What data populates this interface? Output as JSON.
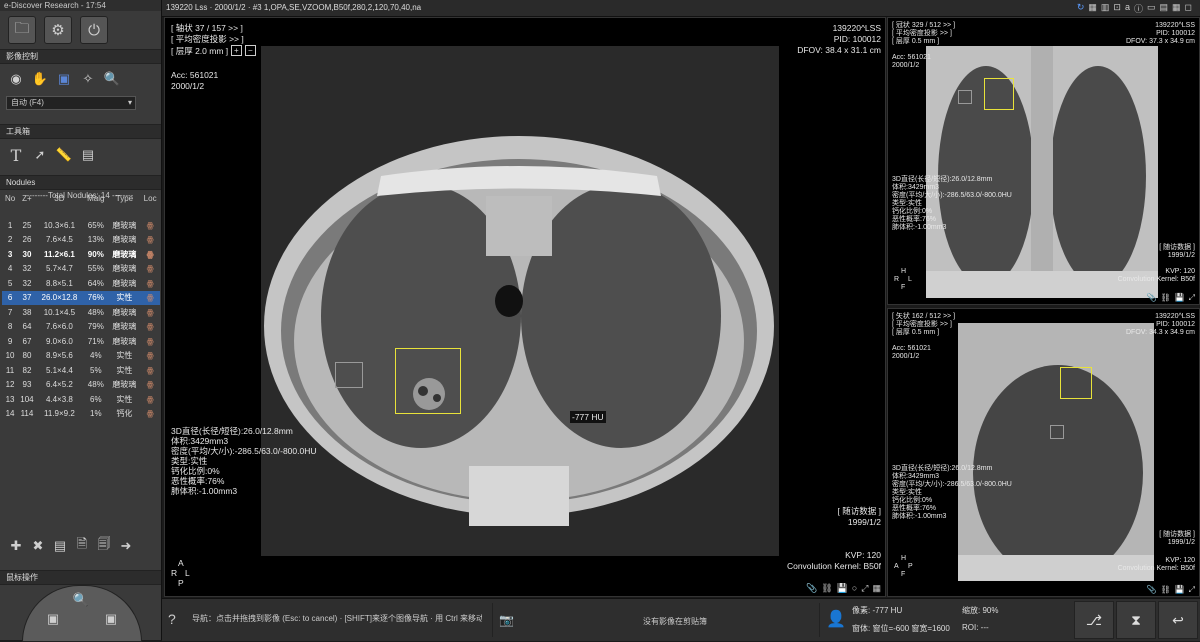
{
  "app": {
    "title": "e-Discover Research - 17:54"
  },
  "left": {
    "sections": {
      "imaging": "影像控制",
      "tools": "工具箱",
      "nodules": "Nodules",
      "mouse": "鼠标操作"
    },
    "mode_dropdown": "自动 (F4)",
    "table_headers": [
      "No",
      "Z+",
      "3D",
      "Malg",
      "Type",
      "Loc"
    ],
    "total_label": "--------Total Nodules: 14 --------",
    "rows": [
      {
        "no": "1",
        "z": "25",
        "d": "10.3×6.1",
        "malg": "65%",
        "type": "磨玻璃"
      },
      {
        "no": "2",
        "z": "26",
        "d": "7.6×4.5",
        "malg": "13%",
        "type": "磨玻璃"
      },
      {
        "no": "3",
        "z": "30",
        "d": "11.2×6.1",
        "malg": "90%",
        "type": "磨玻璃"
      },
      {
        "no": "4",
        "z": "32",
        "d": "5.7×4.7",
        "malg": "55%",
        "type": "磨玻璃"
      },
      {
        "no": "5",
        "z": "32",
        "d": "8.8×5.1",
        "malg": "64%",
        "type": "磨玻璃"
      },
      {
        "no": "6",
        "z": "37",
        "d": "26.0×12.8",
        "malg": "76%",
        "type": "实性"
      },
      {
        "no": "7",
        "z": "38",
        "d": "10.1×4.5",
        "malg": "48%",
        "type": "磨玻璃"
      },
      {
        "no": "8",
        "z": "64",
        "d": "7.6×6.0",
        "malg": "79%",
        "type": "磨玻璃"
      },
      {
        "no": "9",
        "z": "67",
        "d": "9.0×6.0",
        "malg": "71%",
        "type": "磨玻璃"
      },
      {
        "no": "10",
        "z": "80",
        "d": "8.9×5.6",
        "malg": "4%",
        "type": "实性"
      },
      {
        "no": "11",
        "z": "82",
        "d": "5.1×4.4",
        "malg": "5%",
        "type": "实性"
      },
      {
        "no": "12",
        "z": "93",
        "d": "6.4×5.2",
        "malg": "48%",
        "type": "磨玻璃"
      },
      {
        "no": "13",
        "z": "104",
        "d": "4.4×3.8",
        "malg": "6%",
        "type": "实性"
      },
      {
        "no": "14",
        "z": "114",
        "d": "11.9×9.2",
        "malg": "1%",
        "type": "钙化"
      }
    ]
  },
  "topbar": {
    "text": "139220 Lss  ·  2000/1/2  ·  #3 1,OPA,SE,VZOOM,B50f,280,2,120,70,40,na"
  },
  "axial": {
    "tl1": "[ 轴状 37 / 157 >> ]",
    "tl2": "[ 平均密度投影 >> ]",
    "tl3": "[ 层厚 2.0 mm ]",
    "acc": "Acc: 561021",
    "date": "2000/1/2",
    "tr1": "139220^LSS",
    "tr2": "PID: 100012",
    "tr3": "DFOV: 38.4 x 31.1 cm",
    "hu": "-777 HU",
    "m1": "3D直径(长径/短径):26.0/12.8mm",
    "m2": "体积:3429mm3",
    "m3": "密度(平均/大/小):-286.5/63.0/-800.0HU",
    "m4": "类型:实性",
    "m5": "钙化比例:0%",
    "m6": "恶性概率:76%",
    "m7": "肺体积:-1.00mm3",
    "follow": "[ 随访数据 ]",
    "follow_date": "1999/1/2",
    "kvp": "KVP: 120",
    "kernel": "Convolution Kernel: B50f",
    "orient": [
      "A",
      "R",
      "L",
      "P"
    ]
  },
  "coronal": {
    "tl1": "[ 冠状 329 / 512 >> ]",
    "tl2": "[ 平均密度投影 >> ]",
    "tl3": "[ 层厚 0.5 mm ]",
    "acc": "Acc: 561021",
    "date": "2000/1/2",
    "tr1": "139220^LSS",
    "tr2": "PID: 100012",
    "tr3": "DFOV: 37.3 x 34.9 cm",
    "m1": "3D直径(长径/短径):26.0/12.8mm",
    "m2": "体积:3429mm3",
    "m3": "密度(平均/大/小):-286.5/63.0/-800.0HU",
    "m4": "类型:实性",
    "m5": "钙化比例:0%",
    "m6": "恶性概率:76%",
    "m7": "肺体积:-1.00mm3",
    "follow": "[ 随访数据 ]",
    "follow_date": "1999/1/2",
    "kvp": "KVP: 120",
    "kernel": "Convolution Kernel: B50f",
    "orient": [
      "H",
      "R",
      "L",
      "F"
    ]
  },
  "sagittal": {
    "tl1": "[ 矢状 162 / 512 >> ]",
    "tl2": "[ 平均密度投影 >> ]",
    "tl3": "[ 层厚 0.5 mm ]",
    "acc": "Acc: 561021",
    "date": "2000/1/2",
    "tr1": "139220^LSS",
    "tr2": "PID: 100012",
    "tr3": "DFOV: 34.3 x 34.9 cm",
    "m1": "3D直径(长径/短径):26.0/12.8mm",
    "m2": "体积:3429mm3",
    "m3": "密度(平均/大/小):-286.5/63.0/-800.0HU",
    "m4": "类型:实性",
    "m5": "钙化比例:0%",
    "m6": "恶性概率:76%",
    "m7": "肺体积:-1.00mm3",
    "follow": "[ 随访数据 ]",
    "follow_date": "1999/1/2",
    "kvp": "KVP: 120",
    "kernel": "Convolution Kernel: B50f",
    "orient": [
      "H",
      "A",
      "P",
      "F"
    ]
  },
  "status": {
    "nav": "导航：点击并拖拽到影像 (Esc: to cancel) · [SHIFT]来逐个图像导航 · 用 Ctrl 来移动影像",
    "clip": "没有影像在剪贴簿",
    "pixel": "像素: -777 HU",
    "window": "窗体: 窗位=-600 窗宽=1600",
    "zoom": "缩放: 90%",
    "roi": "ROI: ---"
  }
}
